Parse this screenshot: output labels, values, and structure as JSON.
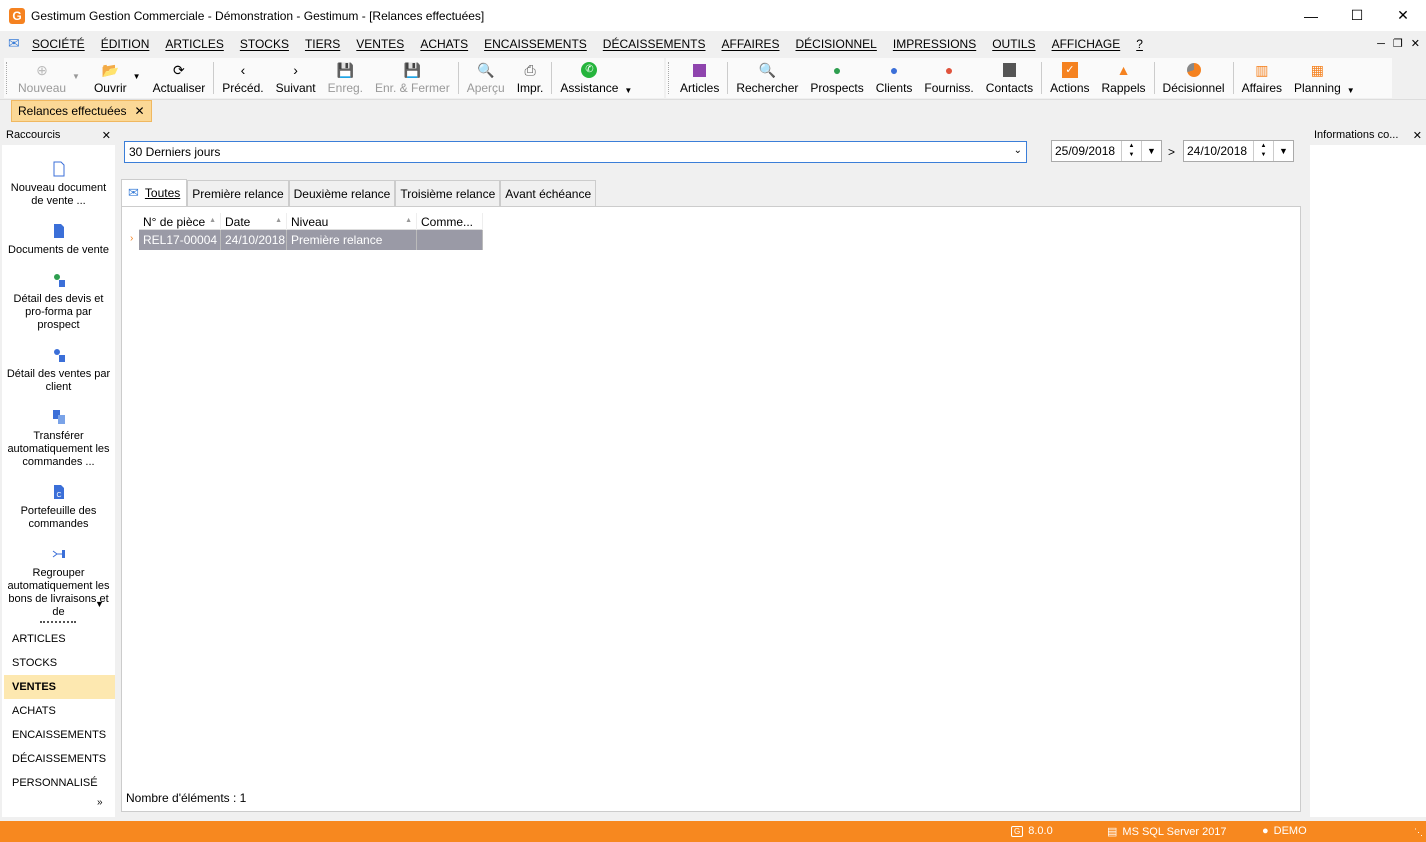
{
  "window": {
    "title": "Gestimum Gestion Commerciale - Démonstration - Gestimum - [Relances effectuées]",
    "logo_letter": "G"
  },
  "menu": [
    "SOCIÉTÉ",
    "ÉDITION",
    "ARTICLES",
    "STOCKS",
    "TIERS",
    "VENTES",
    "ACHATS",
    "ENCAISSEMENTS",
    "DÉCAISSEMENTS",
    "AFFAIRES",
    "DÉCISIONNEL",
    "IMPRESSIONS",
    "OUTILS",
    "AFFICHAGE",
    "?"
  ],
  "toolbar": {
    "nouveau": "Nouveau",
    "ouvrir": "Ouvrir",
    "actualiser": "Actualiser",
    "preced": "Précéd.",
    "suivant": "Suivant",
    "enreg": "Enreg.",
    "enr_fermer": "Enr. & Fermer",
    "apercu": "Aperçu",
    "impr": "Impr.",
    "assistance": "Assistance",
    "articles": "Articles",
    "rechercher": "Rechercher",
    "prospects": "Prospects",
    "clients": "Clients",
    "fourniss": "Fourniss.",
    "contacts": "Contacts",
    "actions": "Actions",
    "rappels": "Rappels",
    "decisionnel": "Décisionnel",
    "affaires": "Affaires",
    "planning": "Planning"
  },
  "doc_tab": "Relances effectuées",
  "sidebar": {
    "title": "Raccourcis",
    "shortcuts": [
      "Nouveau document de vente ...",
      "Documents de vente",
      "Détail des devis et pro-forma par prospect",
      "Détail des ventes par client",
      "Transférer automatiquement les commandes ...",
      "Portefeuille des commandes",
      "Regrouper automatiquement les bons de livraisons et de"
    ],
    "nav": [
      "ARTICLES",
      "STOCKS",
      "VENTES",
      "ACHATS",
      "ENCAISSEMENTS",
      "DÉCAISSEMENTS",
      "PERSONNALISÉ"
    ]
  },
  "filter": {
    "period": "30 Derniers jours",
    "date_from": "25/09/2018",
    "date_to": "24/10/2018",
    "sep": ">"
  },
  "tabs": [
    "Toutes",
    "Première relance",
    "Deuxième relance",
    "Troisième relance",
    "Avant échéance"
  ],
  "grid": {
    "columns": [
      "N° de pièce",
      "Date",
      "Niveau",
      "Comme..."
    ],
    "rows": [
      [
        "REL17-00004",
        "24/10/2018",
        "Première relance",
        ""
      ]
    ]
  },
  "count_label": "Nombre d'éléments : 1",
  "right_panel": {
    "title": "Informations co..."
  },
  "status": {
    "version": "8.0.0",
    "db": "MS SQL Server 2017",
    "user": "DEMO"
  },
  "colors": {
    "accent": "#f7881f",
    "selection": "#9a9aa6",
    "active_nav": "#fde8b0"
  }
}
